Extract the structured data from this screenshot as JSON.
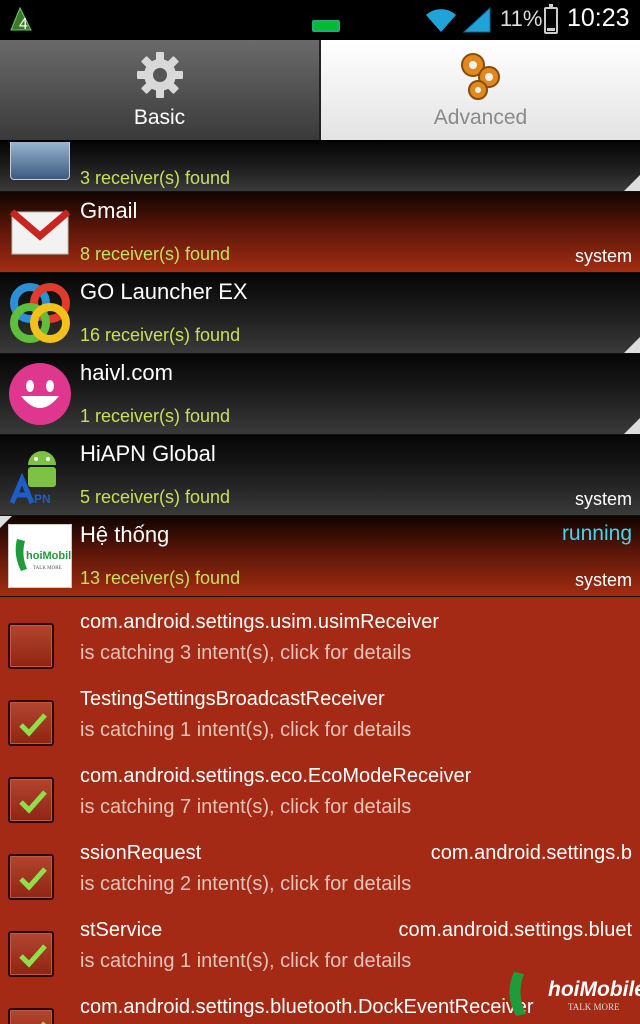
{
  "status_bar": {
    "notification_count": "4",
    "battery_percent": "11%",
    "time": "10:23"
  },
  "tabs": [
    {
      "label": "Basic",
      "icon": "gear-icon",
      "selected": true
    },
    {
      "label": "Advanced",
      "icon": "gears-icon",
      "selected": false
    }
  ],
  "apps": [
    {
      "name": "",
      "count": "3 receiver(s) found",
      "tag": "",
      "state": "",
      "icon": "image-icon"
    },
    {
      "name": "Gmail",
      "count": "8 receiver(s) found",
      "tag": "system",
      "state": "",
      "icon": "gmail-icon"
    },
    {
      "name": "GO Launcher EX",
      "count": "16 receiver(s) found",
      "tag": "",
      "state": "",
      "icon": "go-launcher-icon"
    },
    {
      "name": "haivl.com",
      "count": "1 receiver(s) found",
      "tag": "",
      "state": "",
      "icon": "smiley-icon"
    },
    {
      "name": "HiAPN Global",
      "count": "5 receiver(s) found",
      "tag": "system",
      "state": "",
      "icon": "android-apn-icon"
    },
    {
      "name": "Hệ thống",
      "count": "13 receiver(s) found",
      "tag": "system",
      "state": "running",
      "icon": "thoimobile-icon"
    }
  ],
  "receivers": [
    {
      "name": "com.android.settings.usim.usimReceiver",
      "name_right": "",
      "desc": "is catching 3 intent(s), click for details",
      "checked": false
    },
    {
      "name": "TestingSettingsBroadcastReceiver",
      "name_right": "",
      "desc": "is catching 1 intent(s), click for details",
      "checked": true
    },
    {
      "name": "com.android.settings.eco.EcoModeReceiver",
      "name_right": "",
      "desc": "is catching 7 intent(s), click for details",
      "checked": true
    },
    {
      "name": "ssionRequest",
      "name_right": "com.android.settings.b",
      "desc": "is catching 2 intent(s), click for details",
      "checked": true
    },
    {
      "name": "stService",
      "name_right": "com.android.settings.bluet",
      "desc": "is catching 1 intent(s), click for details",
      "checked": true
    },
    {
      "name": "com.android.settings.bluetooth.DockEventReceiver",
      "name_right": "",
      "desc": "",
      "checked": true
    }
  ],
  "watermark": {
    "brand": "hoiMobile",
    "tagline": "TALK MORE"
  }
}
